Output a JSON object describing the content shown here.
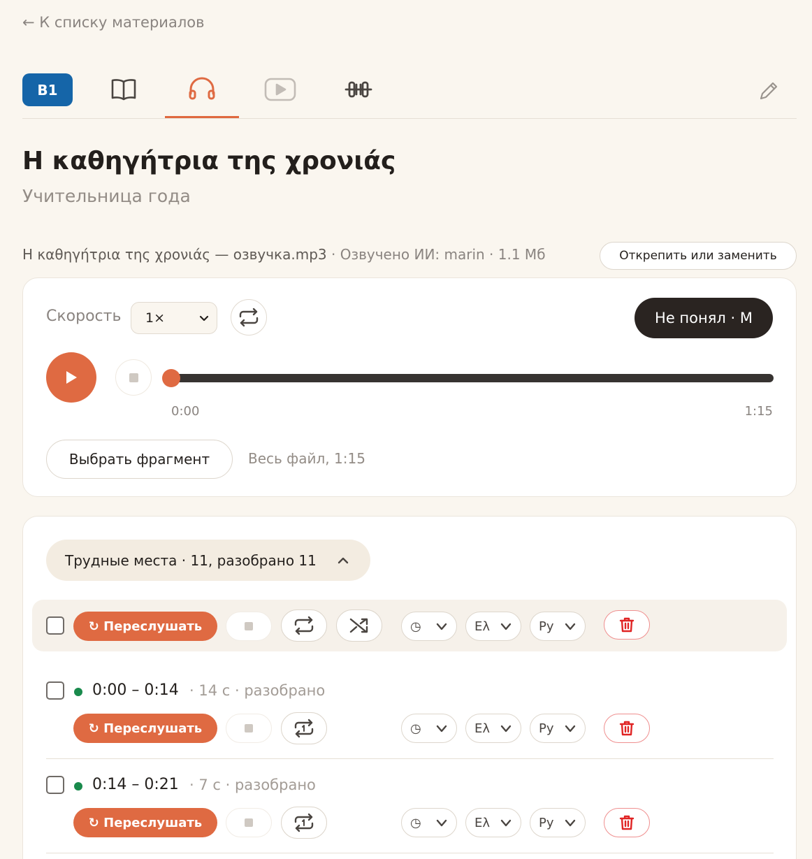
{
  "nav": {
    "back_label": "← К списку материалов"
  },
  "tabs": {
    "level": "B1",
    "items": [
      {
        "name": "book-icon",
        "active": false
      },
      {
        "name": "headphones-icon",
        "active": true
      },
      {
        "name": "video-icon",
        "active": false
      },
      {
        "name": "exercise-icon",
        "active": false
      }
    ],
    "edit": "pencil-icon"
  },
  "material": {
    "title": "Η καθηγήτρια της χρονιάς",
    "subtitle": "Учительница года"
  },
  "file": {
    "name": "Η καθηγήτρια της χρονιάς — озвучка.mp3",
    "meta": " · Озвучено ИИ: marin · 1.1 Мб",
    "detach_label": "Открепить или заменить"
  },
  "player": {
    "speed_label": "Скорость",
    "speed_value": "1×",
    "not_understood_label": "Не понял · M",
    "progress": 0,
    "time_current": "0:00",
    "time_total": "1:15",
    "fragment_button": "Выбрать фрагмент",
    "fragment_info": "Весь файл, 1:15"
  },
  "hard_spots": {
    "toggle_label": "Трудные места · 11, разобрано 11",
    "bulk": {
      "relisten_label": "↻ Переслушать",
      "time_select": "◷",
      "lang1_select": "Ελ",
      "lang2_select": "Ру"
    },
    "segments": [
      {
        "time": "0:00 – 0:14",
        "meta": "· 14 с · разобрано",
        "relisten_label": "↻ Переслушать",
        "time_select": "◷",
        "lang1_select": "Ελ",
        "lang2_select": "Ру"
      },
      {
        "time": "0:14 – 0:21",
        "meta": "· 7 с · разобрано",
        "relisten_label": "↻ Переслушать",
        "time_select": "◷",
        "lang1_select": "Ελ",
        "lang2_select": "Ру"
      }
    ]
  },
  "colors": {
    "accent": "#df6a42",
    "level_badge": "#1565a8",
    "background": "#faf6ef",
    "status_done": "#198a4c",
    "delete": "#e02424"
  }
}
